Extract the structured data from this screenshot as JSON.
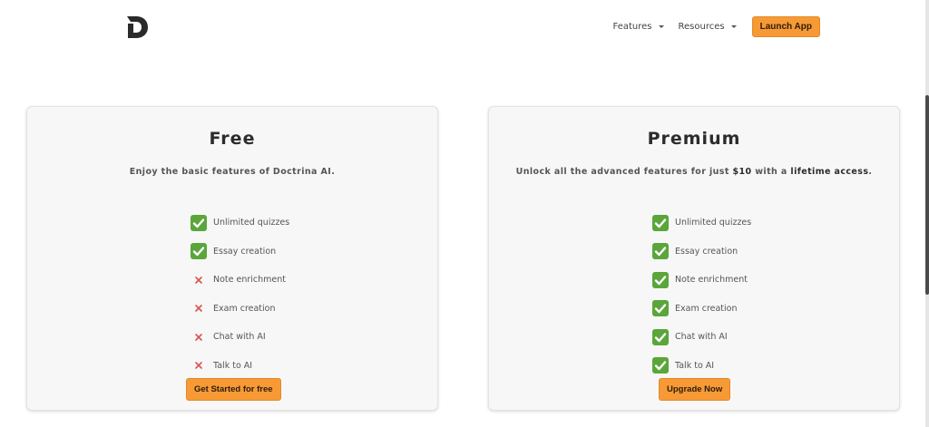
{
  "header": {
    "nav": [
      {
        "label": "Features"
      },
      {
        "label": "Resources"
      }
    ],
    "launch_label": "Launch App"
  },
  "plans": {
    "free": {
      "title": "Free",
      "subtitle": "Enjoy the basic features of Doctrina AI.",
      "features": [
        {
          "label": "Unlimited quizzes",
          "included": true
        },
        {
          "label": "Essay creation",
          "included": true
        },
        {
          "label": "Note enrichment",
          "included": false
        },
        {
          "label": "Exam creation",
          "included": false
        },
        {
          "label": "Chat with AI",
          "included": false
        },
        {
          "label": "Talk to AI",
          "included": false
        }
      ],
      "cta_label": "Get Started for free"
    },
    "premium": {
      "title": "Premium",
      "subtitle_pre": "Unlock all the advanced features for just ",
      "subtitle_price": "$10",
      "subtitle_mid": " with a ",
      "subtitle_strong": "lifetime access",
      "subtitle_end": ".",
      "features": [
        {
          "label": "Unlimited quizzes",
          "included": true
        },
        {
          "label": "Essay creation",
          "included": true
        },
        {
          "label": "Note enrichment",
          "included": true
        },
        {
          "label": "Exam creation",
          "included": true
        },
        {
          "label": "Chat with AI",
          "included": true
        },
        {
          "label": "Talk to AI",
          "included": true
        }
      ],
      "cta_label": "Upgrade Now"
    }
  },
  "icons": {
    "check": "check-mark-icon",
    "cross": "cross-icon"
  },
  "colors": {
    "accent": "#f79a35",
    "check_green": "#5aa63a",
    "cross_red": "#d9534f"
  }
}
